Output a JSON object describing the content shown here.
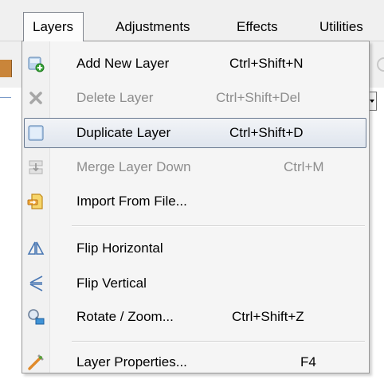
{
  "menubar": {
    "items": [
      {
        "label": "Layers"
      },
      {
        "label": "Adjustments"
      },
      {
        "label": "Effects"
      },
      {
        "label": "Utilities"
      }
    ]
  },
  "menu": {
    "items": [
      {
        "label": "Add New Layer",
        "shortcut": "Ctrl+Shift+N",
        "icon": "add-layer-icon",
        "disabled": false
      },
      {
        "label": "Delete Layer",
        "shortcut": "Ctrl+Shift+Del",
        "icon": "delete-layer-icon",
        "disabled": true
      },
      {
        "label": "Duplicate Layer",
        "shortcut": "Ctrl+Shift+D",
        "icon": "duplicate-layer-icon",
        "disabled": false,
        "highlighted": true
      },
      {
        "label": "Merge Layer Down",
        "shortcut": "Ctrl+M",
        "icon": "merge-layer-down-icon",
        "disabled": true
      },
      {
        "label": "Import From File...",
        "shortcut": "",
        "icon": "import-file-icon",
        "disabled": false
      },
      {
        "label": "Flip Horizontal",
        "shortcut": "",
        "icon": "flip-horizontal-icon",
        "disabled": false
      },
      {
        "label": "Flip Vertical",
        "shortcut": "",
        "icon": "flip-vertical-icon",
        "disabled": false
      },
      {
        "label": "Rotate / Zoom...",
        "shortcut": "Ctrl+Shift+Z",
        "icon": "rotate-zoom-icon",
        "disabled": false
      },
      {
        "label": "Layer Properties...",
        "shortcut": "F4",
        "icon": "layer-properties-icon",
        "disabled": false
      }
    ]
  },
  "colors": {
    "highlight_border": "#6a7a91",
    "disabled_text": "#8d8d8d",
    "menu_background": "#f5f5f5"
  }
}
